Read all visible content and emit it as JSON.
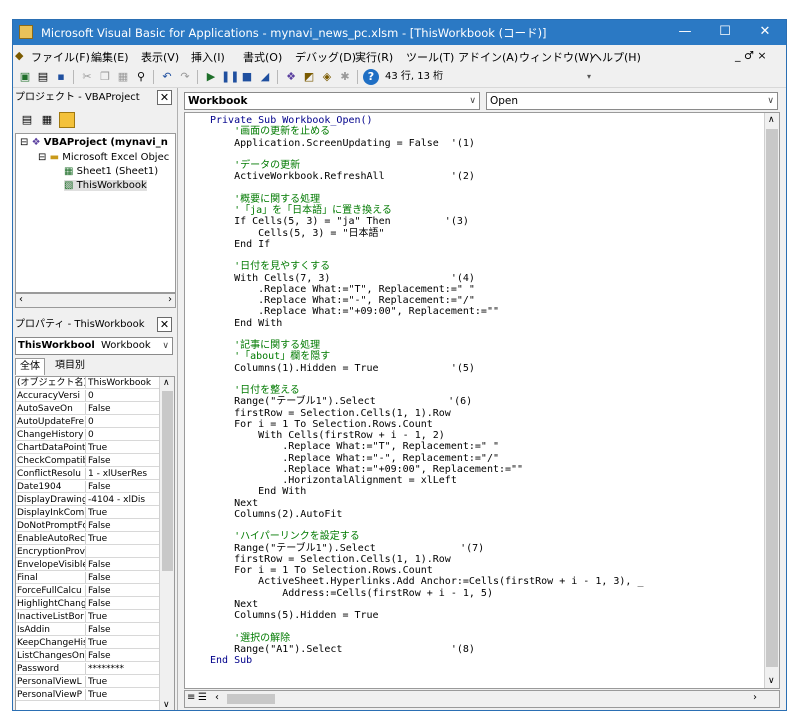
{
  "window": {
    "title": "Microsoft Visual Basic for Applications - mynavi_news_pc.xlsm - [ThisWorkbook (コード)]",
    "minimize": "—",
    "maximize": "☐",
    "close": "✕"
  },
  "menu": [
    "ファイル(F)",
    "編集(E)",
    "表示(V)",
    "挿入(I)",
    "書式(O)",
    "デバッグ(D)",
    "実行(R)",
    "ツール(T)",
    "アドイン(A)",
    "ウィンドウ(W)",
    "ヘルプ(H)"
  ],
  "menu_right": "_ ♂ ×",
  "toolbar": {
    "position": "43 行, 13 桁"
  },
  "project_pane": {
    "title": "プロジェクト - VBAProject",
    "close": "✕",
    "tree": [
      {
        "label": "VBAProject (mynavi_n",
        "level": 0
      },
      {
        "label": "Microsoft Excel Objec",
        "level": 1
      },
      {
        "label": "Sheet1 (Sheet1)",
        "level": 2
      },
      {
        "label": "ThisWorkbook",
        "level": 2
      }
    ]
  },
  "properties_pane": {
    "title": "プロパティ - ThisWorkbook",
    "close": "✕",
    "object_name": "ThisWorkbool",
    "object_type": "Workbook",
    "tabs": [
      "全体",
      "項目別"
    ],
    "rows": [
      [
        "(オブジェクト名)",
        "ThisWorkbook"
      ],
      [
        "AccuracyVersi",
        "0"
      ],
      [
        "AutoSaveOn",
        "False"
      ],
      [
        "AutoUpdateFre",
        "0"
      ],
      [
        "ChangeHistory",
        "0"
      ],
      [
        "ChartDataPoint",
        "True"
      ],
      [
        "CheckCompatib",
        "False"
      ],
      [
        "ConflictResolu",
        "1 - xlUserRes"
      ],
      [
        "Date1904",
        "False"
      ],
      [
        "DisplayDrawing",
        "-4104 - xlDis"
      ],
      [
        "DisplayInkCom",
        "True"
      ],
      [
        "DoNotPromptFo",
        "False"
      ],
      [
        "EnableAutoRec",
        "True"
      ],
      [
        "EncryptionProv",
        ""
      ],
      [
        "EnvelopeVisible",
        "False"
      ],
      [
        "Final",
        "False"
      ],
      [
        "ForceFullCalcu",
        "False"
      ],
      [
        "HighlightChang",
        "False"
      ],
      [
        "InactiveListBor",
        "True"
      ],
      [
        "IsAddin",
        "False"
      ],
      [
        "KeepChangeHis",
        "True"
      ],
      [
        "ListChangesOn",
        "False"
      ],
      [
        "Password",
        "********"
      ],
      [
        "PersonalViewL",
        "True"
      ],
      [
        "PersonalViewP",
        "True"
      ]
    ]
  },
  "code_window": {
    "object": "Workbook",
    "procedure": "Open",
    "lines": [
      {
        "t": "Private Sub Workbook_Open()",
        "c": "kw"
      },
      {
        "t": "    '画面の更新を止める",
        "c": "cm"
      },
      {
        "t": "    Application.ScreenUpdating = False  '(1)",
        "c": ""
      },
      {
        "t": "",
        "c": ""
      },
      {
        "t": "    'データの更新",
        "c": "cm"
      },
      {
        "t": "    ActiveWorkbook.RefreshAll           '(2)",
        "c": ""
      },
      {
        "t": "",
        "c": ""
      },
      {
        "t": "    '概要に関する処理",
        "c": "cm"
      },
      {
        "t": "    '「ja」を「日本語」に置き換える",
        "c": "cm"
      },
      {
        "t": "    If Cells(5, 3) = \"ja\" Then         '(3)",
        "c": ""
      },
      {
        "t": "        Cells(5, 3) = \"日本語\"",
        "c": ""
      },
      {
        "t": "    End If",
        "c": ""
      },
      {
        "t": "",
        "c": ""
      },
      {
        "t": "    '日付を見やすくする",
        "c": "cm"
      },
      {
        "t": "    With Cells(7, 3)                    '(4)",
        "c": ""
      },
      {
        "t": "        .Replace What:=\"T\", Replacement:=\" \"",
        "c": ""
      },
      {
        "t": "        .Replace What:=\"-\", Replacement:=\"/\"",
        "c": ""
      },
      {
        "t": "        .Replace What:=\"+09:00\", Replacement:=\"\"",
        "c": ""
      },
      {
        "t": "    End With",
        "c": ""
      },
      {
        "t": "",
        "c": ""
      },
      {
        "t": "    '記事に関する処理",
        "c": "cm"
      },
      {
        "t": "    '「about」欄を隠す",
        "c": "cm"
      },
      {
        "t": "    Columns(1).Hidden = True            '(5)",
        "c": ""
      },
      {
        "t": "",
        "c": ""
      },
      {
        "t": "    '日付を整える",
        "c": "cm"
      },
      {
        "t": "    Range(\"テーブル1\").Select            '(6)",
        "c": ""
      },
      {
        "t": "    firstRow = Selection.Cells(1, 1).Row",
        "c": ""
      },
      {
        "t": "    For i = 1 To Selection.Rows.Count",
        "c": ""
      },
      {
        "t": "        With Cells(firstRow + i - 1, 2)",
        "c": ""
      },
      {
        "t": "            .Replace What:=\"T\", Replacement:=\" \"",
        "c": ""
      },
      {
        "t": "            .Replace What:=\"-\", Replacement:=\"/\"",
        "c": ""
      },
      {
        "t": "            .Replace What:=\"+09:00\", Replacement:=\"\"",
        "c": ""
      },
      {
        "t": "            .HorizontalAlignment = xlLeft",
        "c": ""
      },
      {
        "t": "        End With",
        "c": ""
      },
      {
        "t": "    Next",
        "c": ""
      },
      {
        "t": "    Columns(2).AutoFit",
        "c": ""
      },
      {
        "t": "",
        "c": ""
      },
      {
        "t": "    'ハイパーリンクを設定する",
        "c": "cm"
      },
      {
        "t": "    Range(\"テーブル1\").Select              '(7)",
        "c": ""
      },
      {
        "t": "    firstRow = Selection.Cells(1, 1).Row",
        "c": ""
      },
      {
        "t": "    For i = 1 To Selection.Rows.Count",
        "c": ""
      },
      {
        "t": "        ActiveSheet.Hyperlinks.Add Anchor:=Cells(firstRow + i - 1, 3), _",
        "c": ""
      },
      {
        "t": "            Address:=Cells(firstRow + i - 1, 5)",
        "c": ""
      },
      {
        "t": "    Next",
        "c": ""
      },
      {
        "t": "    Columns(5).Hidden = True",
        "c": ""
      },
      {
        "t": "",
        "c": ""
      },
      {
        "t": "    '選択の解除",
        "c": "cm"
      },
      {
        "t": "    Range(\"A1\").Select                  '(8)",
        "c": ""
      },
      {
        "t": "End Sub",
        "c": "kw"
      }
    ]
  },
  "colors": {
    "titlebar": "#2b79c4",
    "comment": "#007a00",
    "keyword": "#00008b"
  }
}
